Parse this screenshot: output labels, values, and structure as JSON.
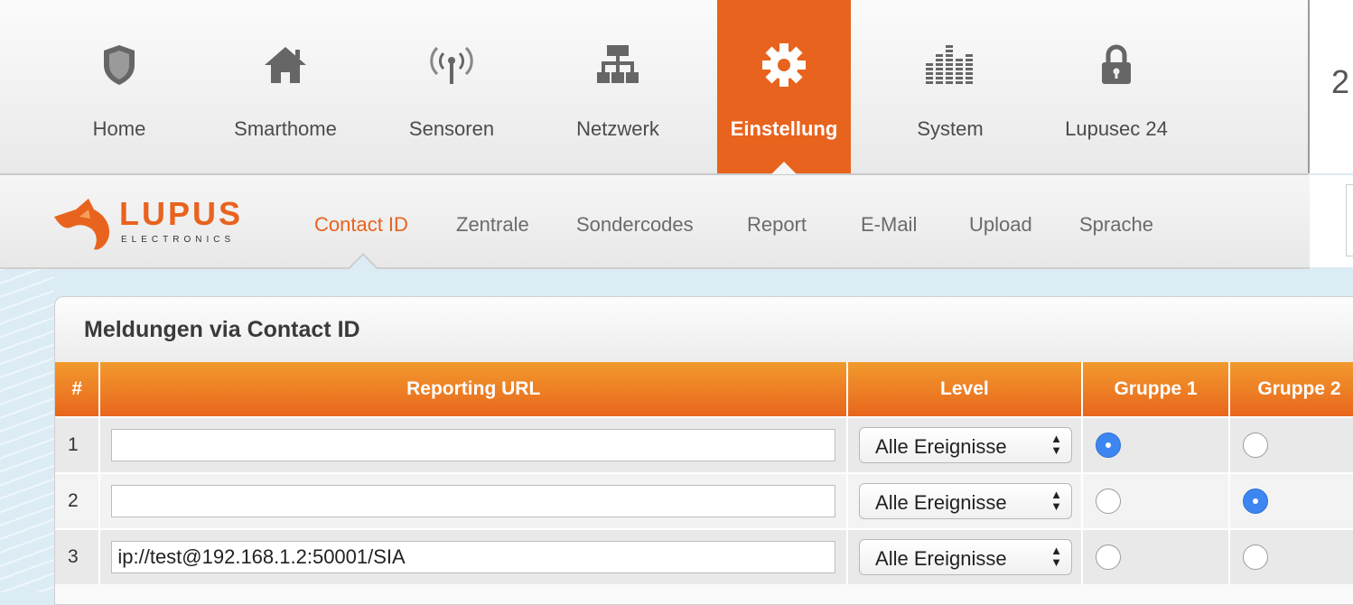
{
  "nav": {
    "items": [
      {
        "label": "Home",
        "icon": "shield-icon"
      },
      {
        "label": "Smarthome",
        "icon": "house-icon"
      },
      {
        "label": "Sensoren",
        "icon": "antenna-icon"
      },
      {
        "label": "Netzwerk",
        "icon": "network-icon"
      },
      {
        "label": "Einstellung",
        "icon": "gear-icon",
        "active": true
      },
      {
        "label": "System",
        "icon": "equalizer-icon"
      },
      {
        "label": "Lupusec 24",
        "icon": "lock-icon"
      }
    ],
    "right_digit": "2",
    "accent_color": "#e8631e"
  },
  "brand": {
    "name": "LUPUS",
    "sub": "ELECTRONICS",
    "icon": "fox-logo-icon"
  },
  "subnav": {
    "items": [
      {
        "label": "Contact ID",
        "active": true
      },
      {
        "label": "Zentrale"
      },
      {
        "label": "Sondercodes"
      },
      {
        "label": "Report"
      },
      {
        "label": "E-Mail"
      },
      {
        "label": "Upload"
      },
      {
        "label": "Sprache"
      }
    ]
  },
  "panel": {
    "title": "Meldungen via Contact ID",
    "columns": [
      "#",
      "Reporting URL",
      "Level",
      "Gruppe 1",
      "Gruppe 2"
    ],
    "rows": [
      {
        "num": "1",
        "url": "",
        "level": "Alle Ereignisse",
        "gruppe1": true,
        "gruppe2": false
      },
      {
        "num": "2",
        "url": "",
        "level": "Alle Ereignisse",
        "gruppe1": false,
        "gruppe2": true
      },
      {
        "num": "3",
        "url": "ip://test@192.168.1.2:50001/SIA",
        "level": "Alle Ereignisse",
        "gruppe1": false,
        "gruppe2": false
      }
    ]
  }
}
